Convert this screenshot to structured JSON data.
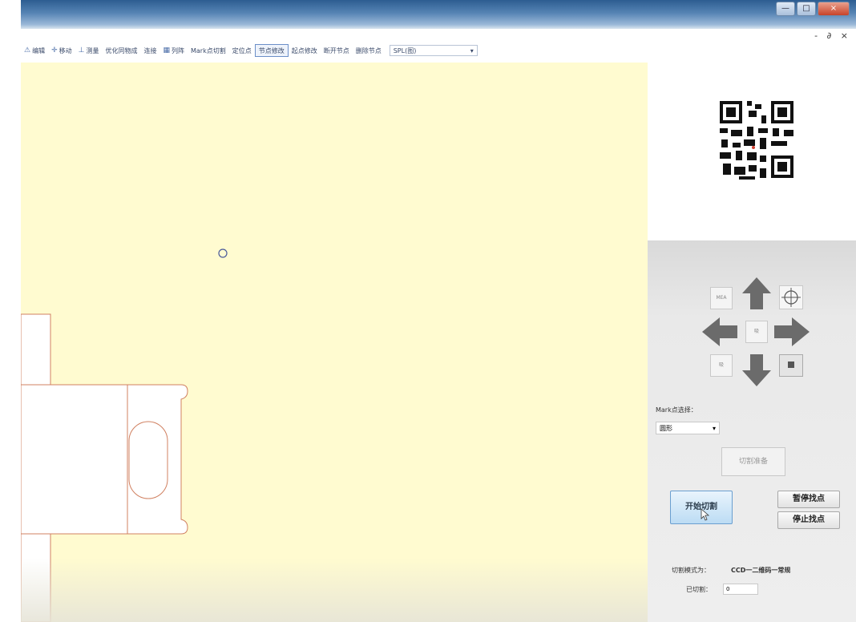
{
  "window": {
    "minimize": "—",
    "maximize": "□",
    "close": "×",
    "mdi_controls": "- ∂ ×"
  },
  "toolbar": {
    "items": [
      {
        "icon": "⚠",
        "label": "编辑"
      },
      {
        "icon": "✛",
        "label": "移动"
      },
      {
        "icon": "⊥",
        "label": "测量"
      },
      {
        "icon": "",
        "label": "优化同物成"
      },
      {
        "icon": "",
        "label": "连接"
      },
      {
        "icon": "▦",
        "label": "列阵"
      },
      {
        "icon": "",
        "label": "Mark点切割"
      },
      {
        "icon": "",
        "label": "定位点"
      },
      {
        "icon": "",
        "label": "节点修改"
      },
      {
        "icon": "",
        "label": "起点修改"
      },
      {
        "icon": "",
        "label": "断开节点"
      },
      {
        "icon": "",
        "label": "删除节点"
      }
    ],
    "select_value": "SPL(图)",
    "select_arrow": "▾"
  },
  "dpad": {
    "top_left": "MEA",
    "center": "吸",
    "bottom_left": "吸"
  },
  "mark_select_label": "Mark点选择：",
  "mark_select_value": "圆形",
  "mark_select_arrow": "▾",
  "buttons": {
    "cut_prepare": "切割准备",
    "start_cut": "开始切割",
    "pause_find": "暂停找点",
    "stop_find": "停止找点"
  },
  "status": {
    "mode_label": "切割模式为：",
    "mode_value": "CCD一二维码一常规",
    "count_label": "已切割：",
    "count_value": "0"
  },
  "colors": {
    "canvas_bg": "#fffbd0",
    "cut_line": "#d08060",
    "accent": "#4a6da8"
  }
}
